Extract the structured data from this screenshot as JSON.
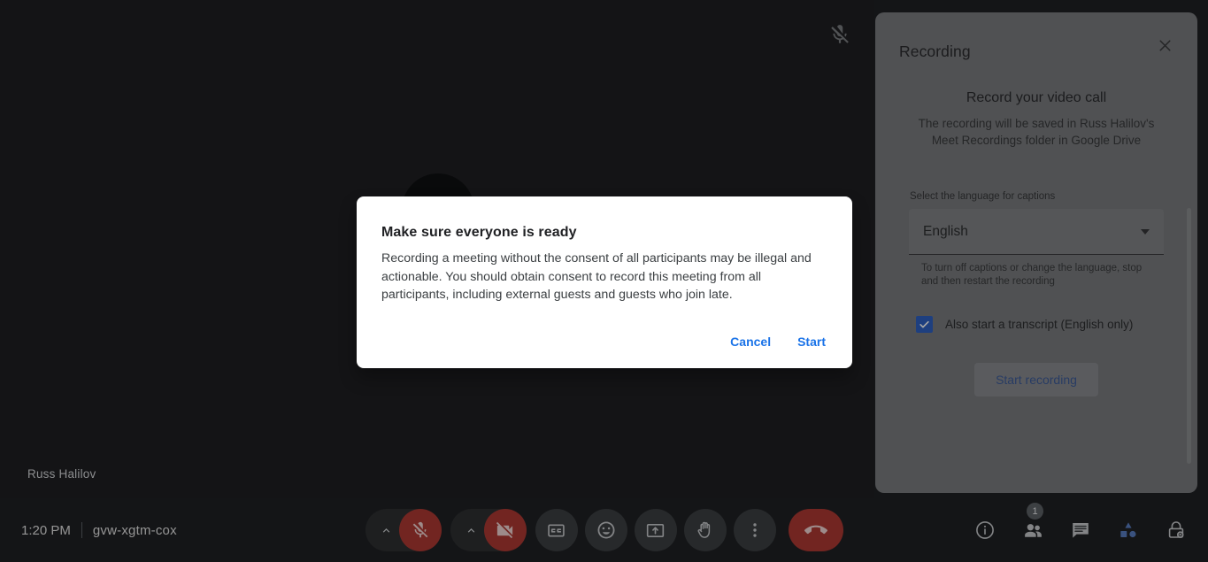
{
  "meeting": {
    "time": "1:20 PM",
    "code": "gvw-xgtm-cox",
    "participant_name": "Russ Halilov",
    "mic_muted_icon": "mic-off-icon"
  },
  "modal": {
    "title": "Make sure everyone is ready",
    "body": "Recording a meeting without the consent of all participants may be illegal and actionable. You should obtain consent to record this meeting from all participants, including external guests and guests who join late.",
    "cancel_label": "Cancel",
    "start_label": "Start"
  },
  "panel": {
    "title": "Recording",
    "close_icon": "close-icon",
    "heading": "Record your video call",
    "subtitle": "The recording will be saved in Russ Halilov's Meet Recordings folder in Google Drive",
    "caption_label": "Select the language for captions",
    "language_value": "English",
    "language_arrow_icon": "chevron-down-icon",
    "language_help": "To turn off captions or change the language, stop and then restart the recording",
    "transcript_label": "Also start a transcript (English only)",
    "transcript_checked": true,
    "transcript_check_icon": "check-icon",
    "start_recording_label": "Start recording"
  },
  "controls": {
    "mic": {
      "name": "microphone-toggle",
      "icon": "mic-off-icon",
      "state": "muted",
      "chevron_icon": "chevron-up-icon"
    },
    "camera": {
      "name": "camera-toggle",
      "icon": "video-off-icon",
      "state": "off",
      "chevron_icon": "chevron-up-icon"
    },
    "captions": {
      "name": "captions-toggle",
      "icon": "closed-captions-icon"
    },
    "reactions": {
      "name": "reactions-button",
      "icon": "emoji-smiley-icon"
    },
    "present": {
      "name": "present-now-button",
      "icon": "present-screen-icon"
    },
    "raise_hand": {
      "name": "raise-hand-button",
      "icon": "hand-icon"
    },
    "more": {
      "name": "more-options-button",
      "icon": "more-vertical-icon"
    },
    "leave": {
      "name": "leave-call-button",
      "icon": "call-end-icon"
    }
  },
  "right_controls": {
    "info": {
      "name": "meeting-details-button",
      "icon": "info-circle-icon"
    },
    "people": {
      "name": "people-button",
      "icon": "people-icon",
      "badge": "1"
    },
    "chat": {
      "name": "chat-button",
      "icon": "chat-bubble-icon"
    },
    "activities": {
      "name": "activities-button",
      "icon": "activities-shapes-icon"
    },
    "host_controls": {
      "name": "host-controls-button",
      "icon": "lock-person-icon"
    }
  },
  "colors": {
    "app_bg": "#202124",
    "control_bg": "#3c4043",
    "danger": "#b03a34",
    "accent_link": "#1a73e8",
    "checkbox": "#2f62c4",
    "activities_blue": "#5a7fc4",
    "panel_dimmed": "#7b7d80"
  }
}
